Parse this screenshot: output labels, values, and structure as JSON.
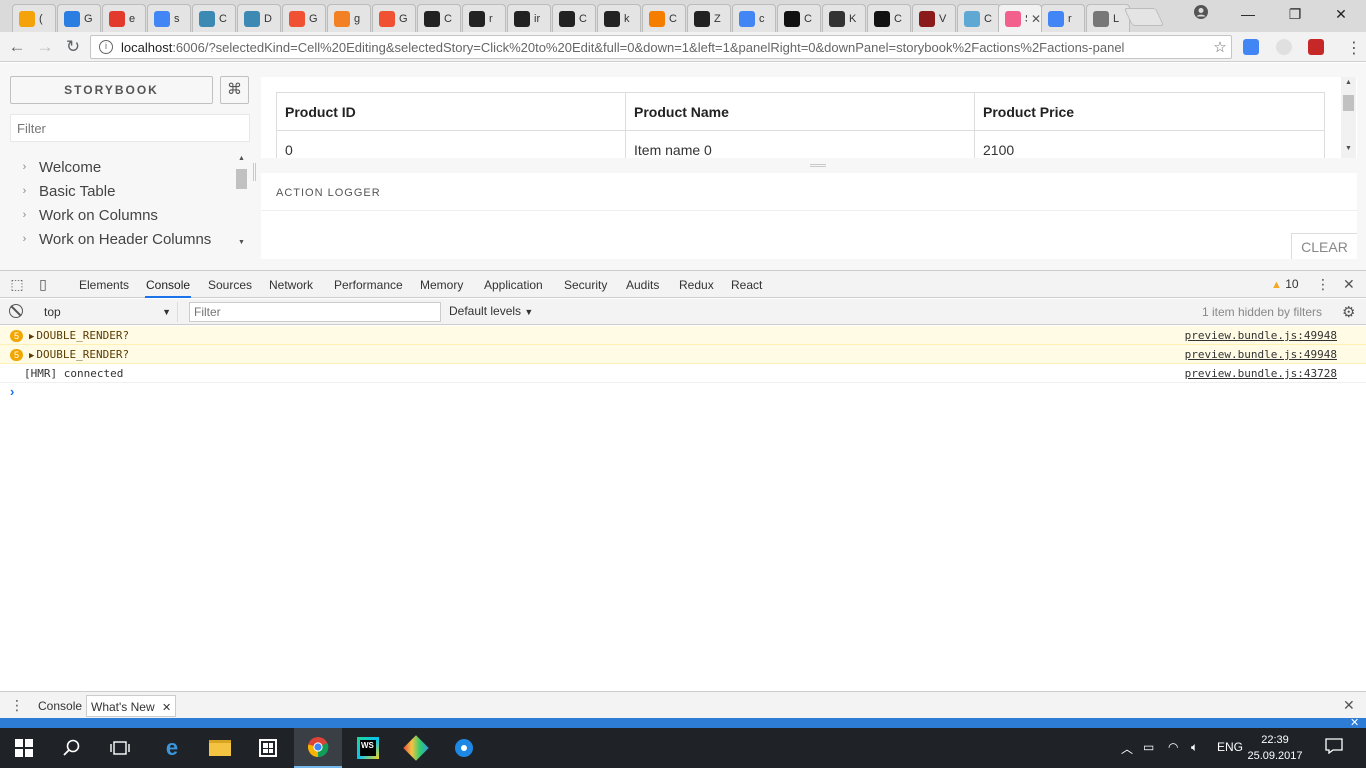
{
  "browser": {
    "tabs": [
      {
        "icon": "generic",
        "label": "(",
        "color": "#f4a30b"
      },
      {
        "icon": "power",
        "label": "G",
        "color": "#2a7de1"
      },
      {
        "icon": "brand",
        "label": "e",
        "color": "#e23b2e"
      },
      {
        "icon": "google",
        "label": "s",
        "color": "#4285f4"
      },
      {
        "icon": "react",
        "label": "C",
        "color": "#3c8ab3"
      },
      {
        "icon": "react",
        "label": "D",
        "color": "#3c8ab3"
      },
      {
        "icon": "git",
        "label": "G",
        "color": "#f05133"
      },
      {
        "icon": "stack",
        "label": "g",
        "color": "#f48024"
      },
      {
        "icon": "git",
        "label": "G",
        "color": "#f05133"
      },
      {
        "icon": "github",
        "label": "C",
        "color": "#222222"
      },
      {
        "icon": "github",
        "label": "r",
        "color": "#222222"
      },
      {
        "icon": "github",
        "label": "ir",
        "color": "#222222"
      },
      {
        "icon": "github",
        "label": "C",
        "color": "#222222"
      },
      {
        "icon": "github",
        "label": "k",
        "color": "#222222"
      },
      {
        "icon": "blogger",
        "label": "C",
        "color": "#f57d00"
      },
      {
        "icon": "tiktok",
        "label": "Z",
        "color": "#222222"
      },
      {
        "icon": "google",
        "label": "c",
        "color": "#4285f4"
      },
      {
        "icon": "cap",
        "label": "C",
        "color": "#111111"
      },
      {
        "icon": "t",
        "label": "K",
        "color": "#333333"
      },
      {
        "icon": "jb",
        "label": "C",
        "color": "#111111"
      },
      {
        "icon": "hat",
        "label": "V",
        "color": "#8b1a1a"
      },
      {
        "icon": "h",
        "label": "C",
        "color": "#5fa8d3"
      },
      {
        "icon": "storybook",
        "label": "St",
        "color": "#f1618c",
        "active": true
      },
      {
        "icon": "google",
        "label": "r",
        "color": "#4285f4"
      },
      {
        "icon": "doc",
        "label": "L",
        "color": "#777777"
      }
    ],
    "close_glyph": "✕",
    "url_host": "localhost",
    "url_rest": ":6006/?selectedKind=Cell%20Editing&selectedStory=Click%20to%20Edit&full=0&down=1&left=1&panelRight=0&downPanel=storybook%2Factions%2Factions-panel"
  },
  "storybook": {
    "brand": "STORYBOOK",
    "shortcut_glyph": "⌘",
    "filter_placeholder": "Filter",
    "stories": [
      "Welcome",
      "Basic Table",
      "Work on Columns",
      "Work on Header Columns"
    ],
    "table": {
      "headers": [
        "Product ID",
        "Product Name",
        "Product Price"
      ],
      "rows": [
        [
          "0",
          "Item name 0",
          "2100"
        ]
      ]
    },
    "action_logger": {
      "title": "ACTION LOGGER",
      "clear_label": "CLEAR"
    }
  },
  "devtools": {
    "tabs": [
      "Elements",
      "Console",
      "Sources",
      "Network",
      "Performance",
      "Memory",
      "Application",
      "Security",
      "Audits",
      "Redux",
      "React"
    ],
    "active_tab": "Console",
    "warning_count": "10",
    "context": "top",
    "filter_placeholder": "Filter",
    "levels": "Default levels",
    "hidden_note": "1 item hidden by filters",
    "messages": [
      {
        "type": "warn",
        "count": "5",
        "text": "DOUBLE_RENDER?",
        "source": "preview.bundle.js:49948"
      },
      {
        "type": "warn",
        "count": "5",
        "text": "DOUBLE_RENDER?",
        "source": "preview.bundle.js:49948"
      },
      {
        "type": "log",
        "count": "",
        "text": "[HMR] connected",
        "source": "preview.bundle.js:43728"
      }
    ],
    "drawer_tabs": [
      "Console",
      "What's New"
    ]
  },
  "taskbar": {
    "language": "ENG",
    "time": "22:39",
    "date": "25.09.2017"
  }
}
